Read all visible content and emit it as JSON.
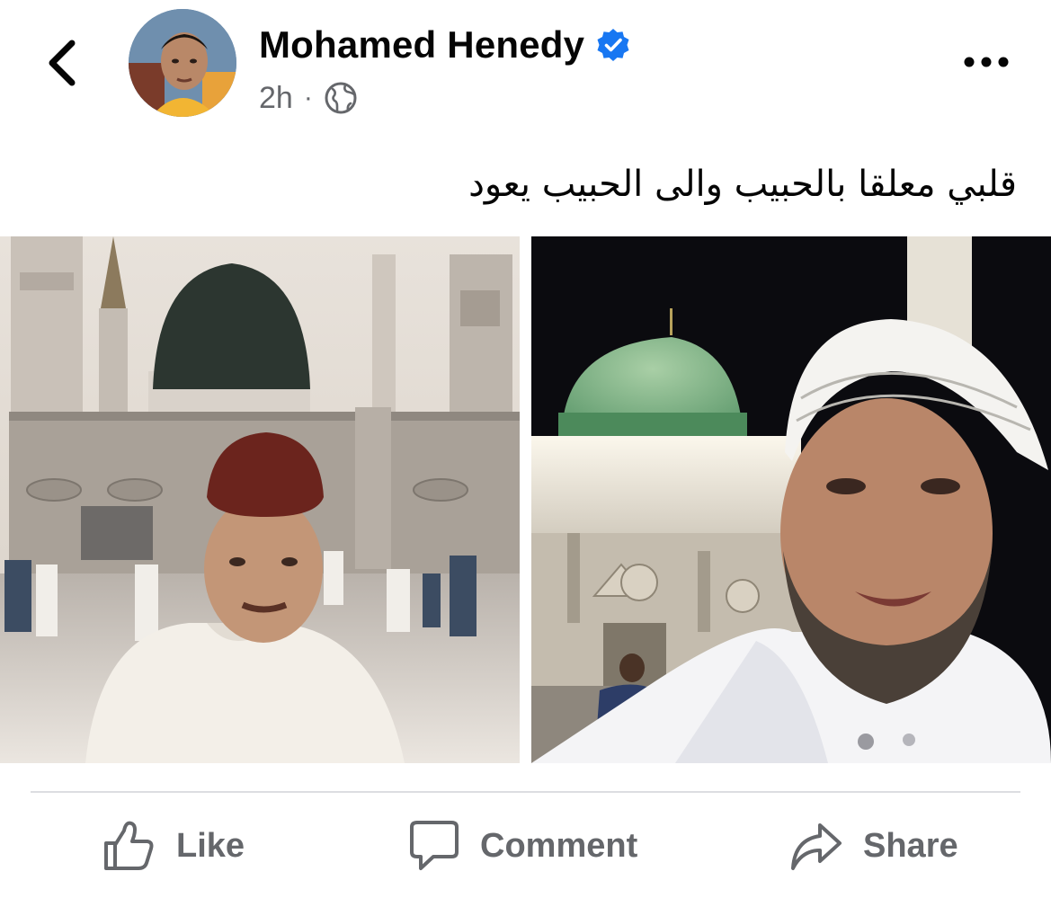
{
  "header": {
    "back_icon": "chevron-left-icon",
    "author_name": "Mohamed Henedy",
    "verified_icon": "verified-badge-icon",
    "time": "2h",
    "separator": "·",
    "audience_icon": "globe-icon",
    "more_icon": "more-horizontal-icon"
  },
  "post": {
    "text": "قلبي معلقا بالحبيب والى الحبيب يعود",
    "photos": [
      {
        "name": "photo-left",
        "alt_kind": "older-photo-sepia"
      },
      {
        "name": "photo-right",
        "alt_kind": "night-selfie"
      }
    ]
  },
  "actions": [
    {
      "label": "Like",
      "icon": "thumbs-up-icon"
    },
    {
      "label": "Comment",
      "icon": "comment-bubble-icon"
    },
    {
      "label": "Share",
      "icon": "share-arrow-icon"
    }
  ],
  "colors": {
    "text_primary": "#050505",
    "text_secondary": "#65676b",
    "verified_blue": "#1877f2",
    "divider": "#dcdde1"
  }
}
